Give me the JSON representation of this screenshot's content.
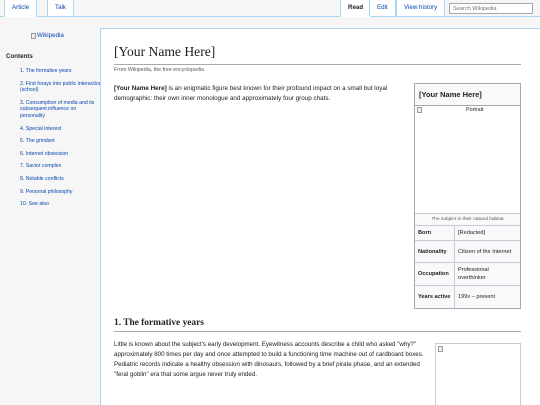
{
  "tabs": {
    "article": "Article",
    "talk": "Talk",
    "read": "Read",
    "edit": "Edit",
    "history": "View history"
  },
  "search": {
    "placeholder": "Search Wikipedia"
  },
  "sidebar": {
    "logo_alt": "Wikipedia",
    "contents_title": "Contents",
    "toc": [
      "1. The formative years",
      "2. First forays into public interaction (school)",
      "3. Consumption of media and its subsequent influence on personality",
      "4. Special interest",
      "5. The grindset",
      "6. Internet obsession",
      "7. Savior complex",
      "8. Notable conflicts",
      "9. Personal philosophy",
      "10. See also"
    ]
  },
  "article": {
    "title": "[Your Name Here]",
    "tagline": "From Wikipedia, the free encyclopedia",
    "intro_bold": "[Your Name Here]",
    "intro_rest": " is an enigmatic figure best known for their profound impact on a small but loyal demographic: their own inner monologue and approximately four group chats.",
    "section1_heading": "1. The formative years",
    "section1_text": "Little is known about the subject's early development. Eyewitness accounts describe a child who asked \"why?\" approximately 800 times per day and once attempted to build a functioning time machine out of cardboard boxes. Pediatric records indicate a healthy obsession with dinosaurs, followed by a brief pirate phase, and an extended \"feral goblin\" era that some argue never truly ended."
  },
  "infobox": {
    "title": "[Your Name Here]",
    "image_alt": "Portrait",
    "caption": "The subject in their natural habitat",
    "rows": [
      {
        "label": "Born",
        "value": "[Redacted]"
      },
      {
        "label": "Nationality",
        "value": "Citizen of the Internet"
      },
      {
        "label": "Occupation",
        "value": "Professional overthinker"
      },
      {
        "label": "Years active",
        "value": "199x – present"
      }
    ]
  }
}
